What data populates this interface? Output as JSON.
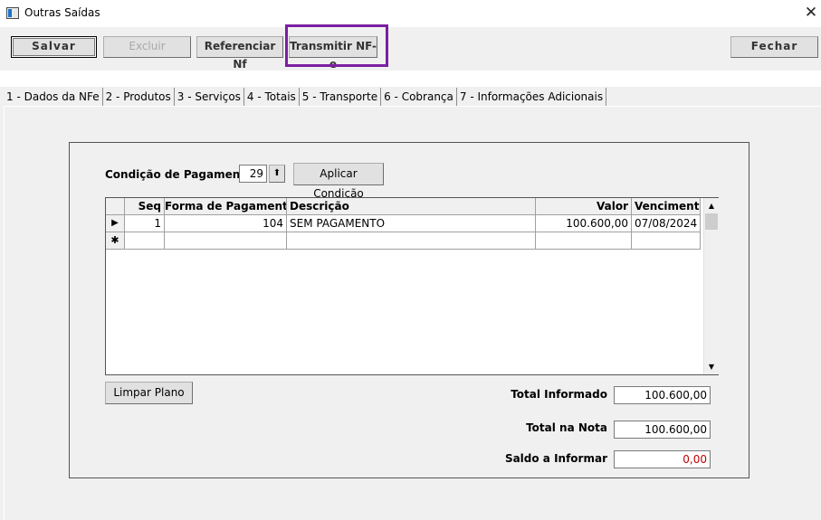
{
  "window": {
    "title": "Outras Saídas",
    "close_glyph": "✕"
  },
  "toolbar": {
    "save_label": "Salvar",
    "delete_label": "Excluir",
    "reference_label": "Referenciar Nf",
    "transmit_label": "Transmitir NF-e",
    "close_label": "Fechar"
  },
  "tabs": [
    {
      "label": "1 - Dados da NFe"
    },
    {
      "label": "2 - Produtos"
    },
    {
      "label": "3 - Serviços"
    },
    {
      "label": "4 - Totais"
    },
    {
      "label": "5 - Transporte"
    },
    {
      "label": "6 - Cobrança"
    },
    {
      "label": "7 - Informações Adicionais"
    }
  ],
  "payment": {
    "condition_label": "Condição de Pagamento",
    "condition_value": "29",
    "spin_glyph": "⬆",
    "apply_label": "Aplicar Condição"
  },
  "grid": {
    "columns": {
      "seq": "Seq",
      "forma": "Forma de Pagamento",
      "descricao": "Descrição",
      "valor": "Valor",
      "vencimento": "Vencimento"
    },
    "rows": [
      {
        "indicator": "▶",
        "seq": "1",
        "forma": "104",
        "descricao": "SEM PAGAMENTO",
        "valor": "100.600,00",
        "vencimento": "07/08/2024"
      }
    ],
    "new_row_indicator": "✱",
    "scroll_up_glyph": "▲",
    "scroll_down_glyph": "▼"
  },
  "actions": {
    "clear_label": "Limpar Plano"
  },
  "totals": {
    "informado_label": "Total Informado",
    "informado_value": "100.600,00",
    "nota_label": "Total na Nota",
    "nota_value": "100.600,00",
    "saldo_label": "Saldo a Informar",
    "saldo_value": "0,00"
  },
  "colors": {
    "highlight": "#7b1fa2",
    "saldo": "#c00000"
  }
}
